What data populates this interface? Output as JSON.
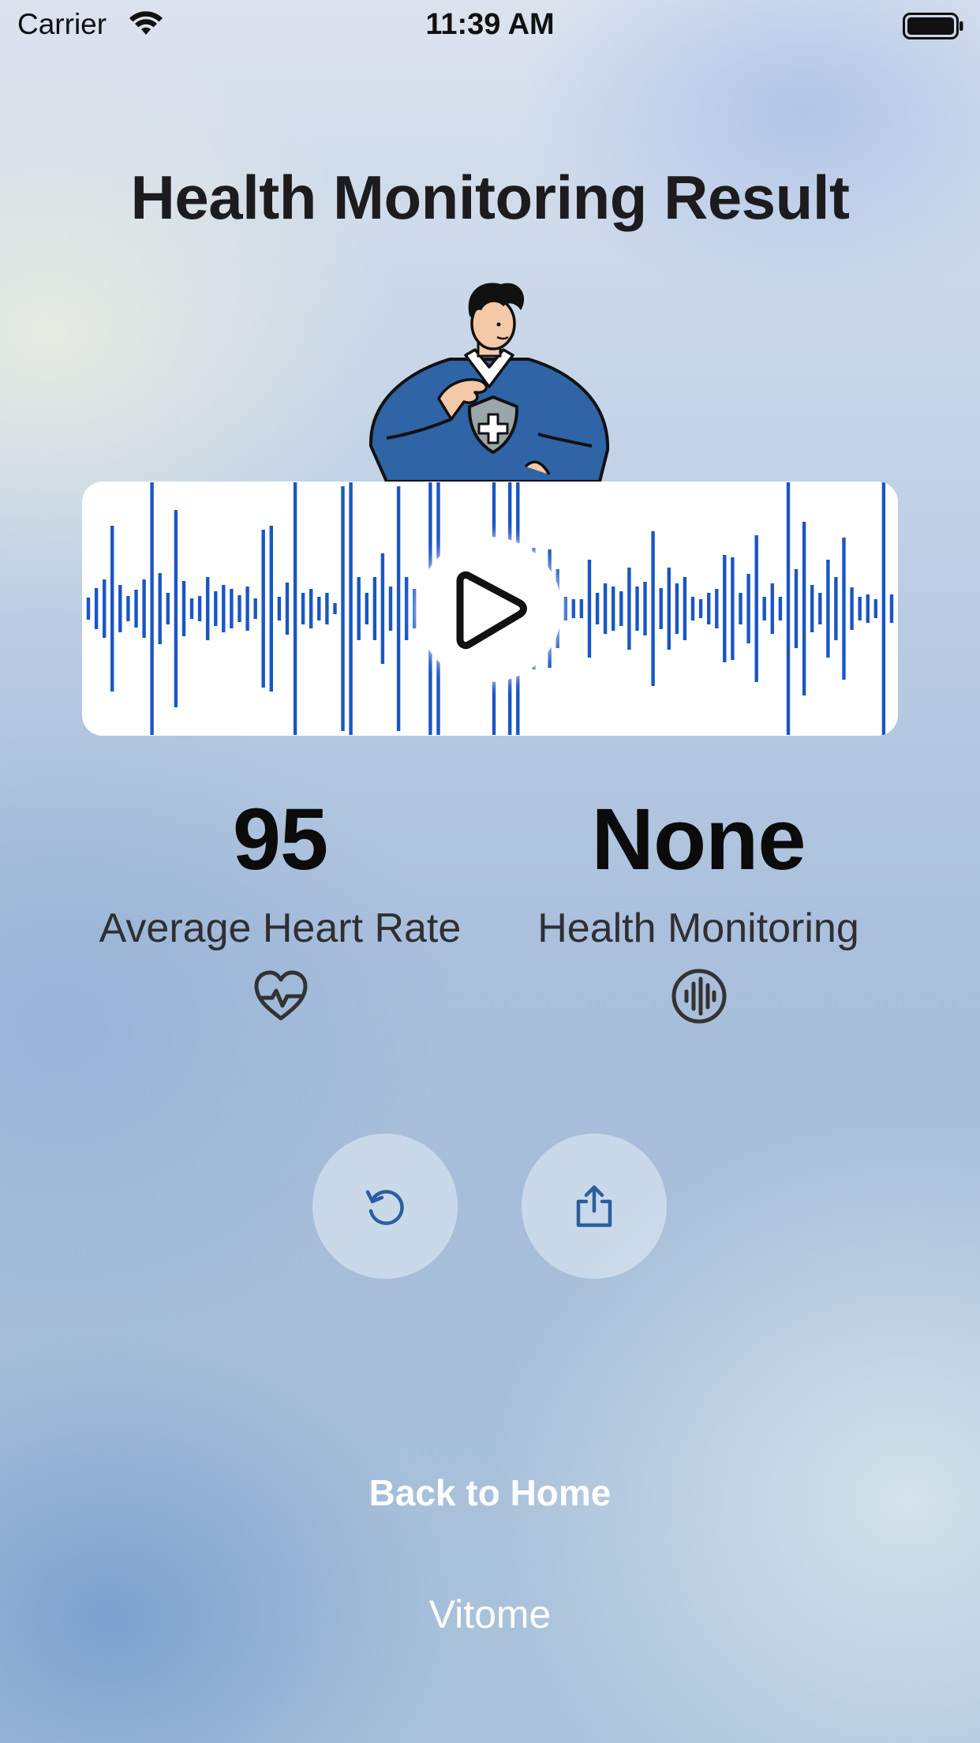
{
  "status_bar": {
    "carrier": "Carrier",
    "time": "11:39 AM",
    "icons": [
      "wifi-icon",
      "battery-icon"
    ]
  },
  "header": {
    "title": "Health Monitoring Result"
  },
  "illustration": {
    "icon": "doctor-illustration"
  },
  "waveform": {
    "accent_color": "#1a56c4",
    "play_icon": "play-icon"
  },
  "stats": {
    "heart_rate": {
      "value": "95",
      "label": "Average Heart Rate",
      "icon": "heart-pulse-icon"
    },
    "health_monitoring": {
      "value": "None",
      "label": "Health Monitoring",
      "icon": "audio-wave-icon"
    }
  },
  "actions": {
    "retry_icon": "retry-icon",
    "share_icon": "share-icon",
    "icon_color": "#2a5f9e"
  },
  "footer": {
    "back_home": "Back to Home",
    "brand": "Vitome"
  }
}
